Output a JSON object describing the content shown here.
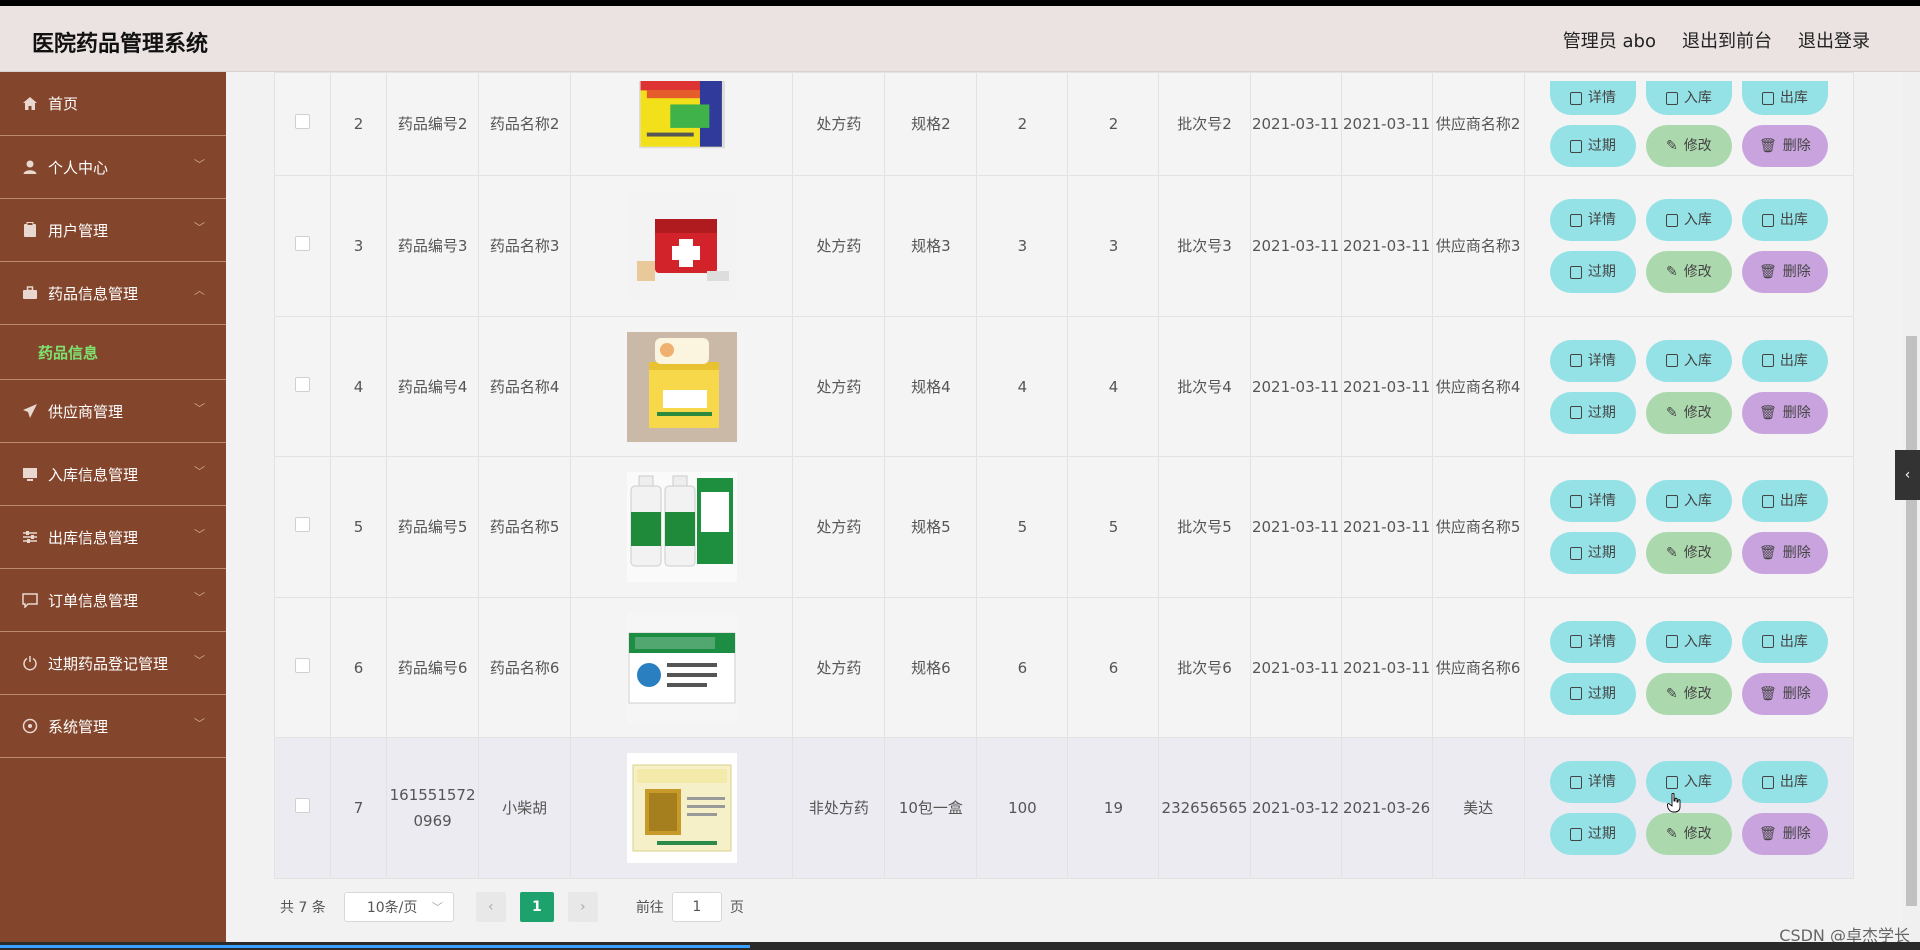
{
  "app": {
    "title": "医院药品管理系统"
  },
  "header": {
    "admin_label": "管理员 abo",
    "front_label": "退出到前台",
    "logout_label": "退出登录"
  },
  "sidebar": {
    "items": [
      {
        "label": "首页",
        "icon": "home-icon"
      },
      {
        "label": "个人中心",
        "icon": "user-icon"
      },
      {
        "label": "用户管理",
        "icon": "clipboard-icon"
      },
      {
        "label": "药品信息管理",
        "icon": "briefcase-icon"
      },
      {
        "label": "供应商管理",
        "icon": "paper-plane-icon"
      },
      {
        "label": "入库信息管理",
        "icon": "monitor-icon"
      },
      {
        "label": "出库信息管理",
        "icon": "sliders-icon"
      },
      {
        "label": "订单信息管理",
        "icon": "message-icon"
      },
      {
        "label": "过期药品登记管理",
        "icon": "power-icon"
      },
      {
        "label": "系统管理",
        "icon": "settings-icon"
      }
    ],
    "active_sub": "药品信息"
  },
  "buttons": {
    "detail": "详情",
    "stock_in": "入库",
    "stock_out": "出库",
    "expire": "过期",
    "edit": "修改",
    "delete": "删除"
  },
  "table": {
    "rows": [
      {
        "idx": "2",
        "code": "药品编号2",
        "name": "药品名称2",
        "type": "处方药",
        "spec": "规格2",
        "qty": "2",
        "price": "2",
        "batch": "批次号2",
        "prod_date": "2021-03-11",
        "exp_date": "2021-03-11",
        "supplier": "供应商名称2",
        "image": "yellow-medicine-box"
      },
      {
        "idx": "3",
        "code": "药品编号3",
        "name": "药品名称3",
        "type": "处方药",
        "spec": "规格3",
        "qty": "3",
        "price": "3",
        "batch": "批次号3",
        "prod_date": "2021-03-11",
        "exp_date": "2021-03-11",
        "supplier": "供应商名称3",
        "image": "red-first-aid-kit"
      },
      {
        "idx": "4",
        "code": "药品编号4",
        "name": "药品名称4",
        "type": "处方药",
        "spec": "规格4",
        "qty": "4",
        "price": "4",
        "batch": "批次号4",
        "prod_date": "2021-03-11",
        "exp_date": "2021-03-11",
        "supplier": "供应商名称4",
        "image": "kids-medicine-box"
      },
      {
        "idx": "5",
        "code": "药品编号5",
        "name": "药品名称5",
        "type": "处方药",
        "spec": "规格5",
        "qty": "5",
        "price": "5",
        "batch": "批次号5",
        "prod_date": "2021-03-11",
        "exp_date": "2021-03-11",
        "supplier": "供应商名称5",
        "image": "green-bottles"
      },
      {
        "idx": "6",
        "code": "药品编号6",
        "name": "药品名称6",
        "type": "处方药",
        "spec": "规格6",
        "qty": "6",
        "price": "6",
        "batch": "批次号6",
        "prod_date": "2021-03-11",
        "exp_date": "2021-03-11",
        "supplier": "供应商名称6",
        "image": "cold-granules-box"
      },
      {
        "idx": "7",
        "code": "1615515720969",
        "name": "小柴胡",
        "type": "非处方药",
        "spec": "10包一盒",
        "qty": "100",
        "price": "19",
        "batch": "232656565",
        "prod_date": "2021-03-12",
        "exp_date": "2021-03-26",
        "supplier": "美达",
        "image": "xiaochaihu-box"
      }
    ]
  },
  "pager": {
    "total": "共 7 条",
    "page_size": "10条/页",
    "current": "1",
    "goto_label": "前往",
    "goto_value": "1",
    "page_unit": "页"
  },
  "watermark": "CSDN @卓杰学长"
}
